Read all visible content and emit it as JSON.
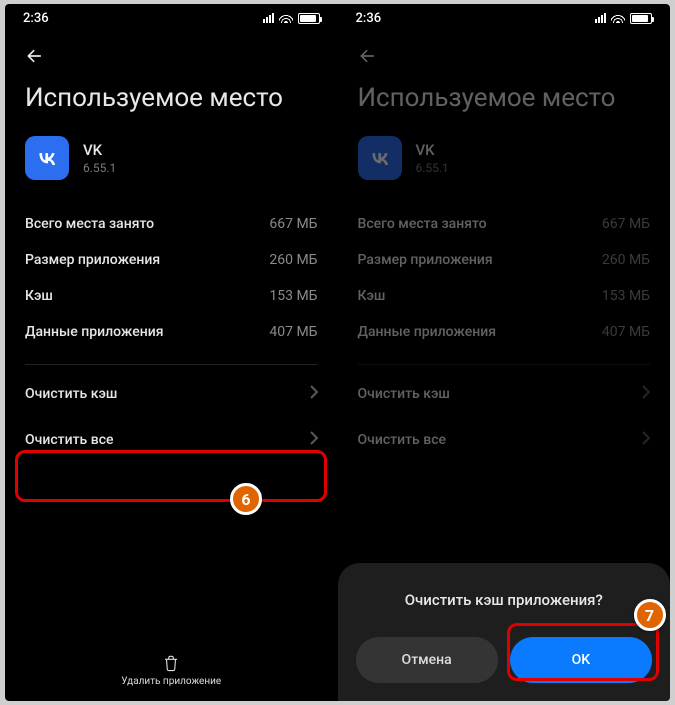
{
  "status": {
    "time": "2:36"
  },
  "page": {
    "title": "Используемое место",
    "app": {
      "name": "VK",
      "version": "6.55.1"
    },
    "stats": [
      {
        "label": "Всего места занято",
        "value": "667 МБ"
      },
      {
        "label": "Размер приложения",
        "value": "260 МБ"
      },
      {
        "label": "Кэш",
        "value": "153 МБ"
      },
      {
        "label": "Данные приложения",
        "value": "407 МБ"
      }
    ],
    "actions": {
      "clear_cache": "Очистить кэш",
      "clear_all": "Очистить все"
    },
    "footer": "Удалить приложение"
  },
  "dialog": {
    "title": "Очистить кэш приложения?",
    "cancel": "Отмена",
    "ok": "OK"
  },
  "annotations": {
    "step6": "6",
    "step7": "7"
  }
}
